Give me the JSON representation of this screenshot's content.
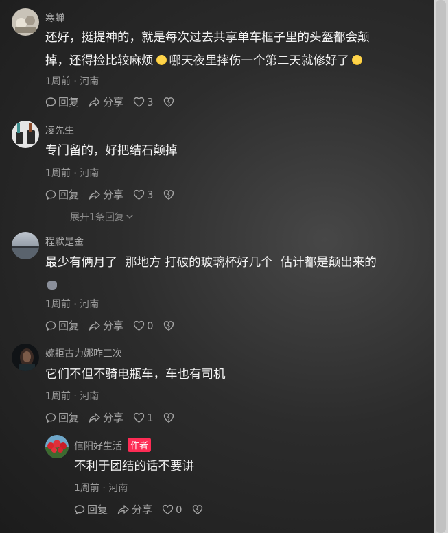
{
  "comments": [
    {
      "username": "寒蝉",
      "text_line1": "还好，挺提神的，就是每次过去共享单车框子里的头盔都会颠",
      "text_line2a": "掉，还得捡比较麻烦",
      "text_line2b": "哪天夜里摔伤一个第二天就修好了",
      "time_location": "1周前 · 河南",
      "reply_label": "回复",
      "share_label": "分享",
      "likes": "3"
    },
    {
      "username": "凌先生",
      "text": "专门留的，好把结石颠掉",
      "time_location": "1周前 · 河南",
      "reply_label": "回复",
      "share_label": "分享",
      "likes": "3",
      "expand_label": "展开1条回复"
    },
    {
      "username": "程默是金",
      "text": "最少有俩月了  那地方 打破的玻璃杯好几个  估计都是颠出来的",
      "time_location": "1周前 · 河南",
      "reply_label": "回复",
      "share_label": "分享",
      "likes": "0"
    },
    {
      "username": "婉拒古力娜咋三次",
      "text": "它们不但不骑电瓶车，车也有司机",
      "time_location": "1周前 · 河南",
      "reply_label": "回复",
      "share_label": "分享",
      "likes": "1"
    }
  ],
  "reply": {
    "username": "信阳好生活",
    "badge": "作者",
    "text": "不利于团结的话不要讲",
    "time_location": "1周前 · 河南",
    "reply_label": "回复",
    "share_label": "分享",
    "likes": "0"
  },
  "colors": {
    "accent": "#fe2c55",
    "text": "#f2f2f2",
    "meta": "#9a9a9a"
  },
  "icons": [
    "comment-icon",
    "share-icon",
    "heart-icon",
    "dislike-icon"
  ]
}
